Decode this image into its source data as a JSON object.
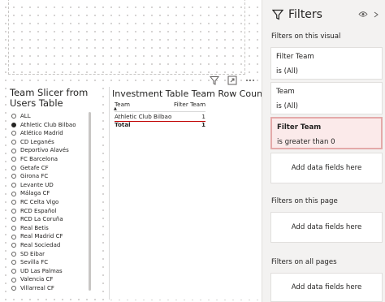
{
  "slicer": {
    "title": "Team Slicer from Users Table",
    "items": [
      {
        "label": "ALL",
        "selected": false
      },
      {
        "label": "Athletic Club Bilbao",
        "selected": true
      },
      {
        "label": "Atlético Madrid",
        "selected": false
      },
      {
        "label": "CD Leganés",
        "selected": false
      },
      {
        "label": "Deportivo Alavés",
        "selected": false
      },
      {
        "label": "FC Barcelona",
        "selected": false
      },
      {
        "label": "Getafe CF",
        "selected": false
      },
      {
        "label": "Girona FC",
        "selected": false
      },
      {
        "label": "Levante UD",
        "selected": false
      },
      {
        "label": "Málaga CF",
        "selected": false
      },
      {
        "label": "RC Celta Vigo",
        "selected": false
      },
      {
        "label": "RCD Español",
        "selected": false
      },
      {
        "label": "RCD La Coruña",
        "selected": false
      },
      {
        "label": "Real Betis",
        "selected": false
      },
      {
        "label": "Real Madrid CF",
        "selected": false
      },
      {
        "label": "Real Sociedad",
        "selected": false
      },
      {
        "label": "SD Eibar",
        "selected": false
      },
      {
        "label": "Sevilla FC",
        "selected": false
      },
      {
        "label": "UD Las Palmas",
        "selected": false
      },
      {
        "label": "Valencia CF",
        "selected": false
      },
      {
        "label": "Villarreal CF",
        "selected": false
      }
    ]
  },
  "table": {
    "title": "Investment Table Team Row Count",
    "columns": [
      "Team",
      "Filter Team"
    ],
    "rows": [
      {
        "team": "Athletic Club Bilbao",
        "value": "1"
      }
    ],
    "total_label": "Total",
    "total_value": "1"
  },
  "filters": {
    "title": "Filters",
    "on_visual_label": "Filters on this visual",
    "cards": [
      {
        "title": "Filter Team",
        "subtitle": "is (All)"
      },
      {
        "title": "Team",
        "subtitle": "is (All)"
      },
      {
        "title": "Filter Team",
        "subtitle": "is greater than 0"
      }
    ],
    "add_fields_label": "Add data fields here",
    "on_page_label": "Filters on this page",
    "on_all_pages_label": "Filters on all pages"
  },
  "colors": {
    "highlight_border": "#e4a9a9",
    "highlight_bg": "#fbeaea",
    "pane_bg": "#f3f2f1",
    "selected_row_underline": "#c00000"
  }
}
